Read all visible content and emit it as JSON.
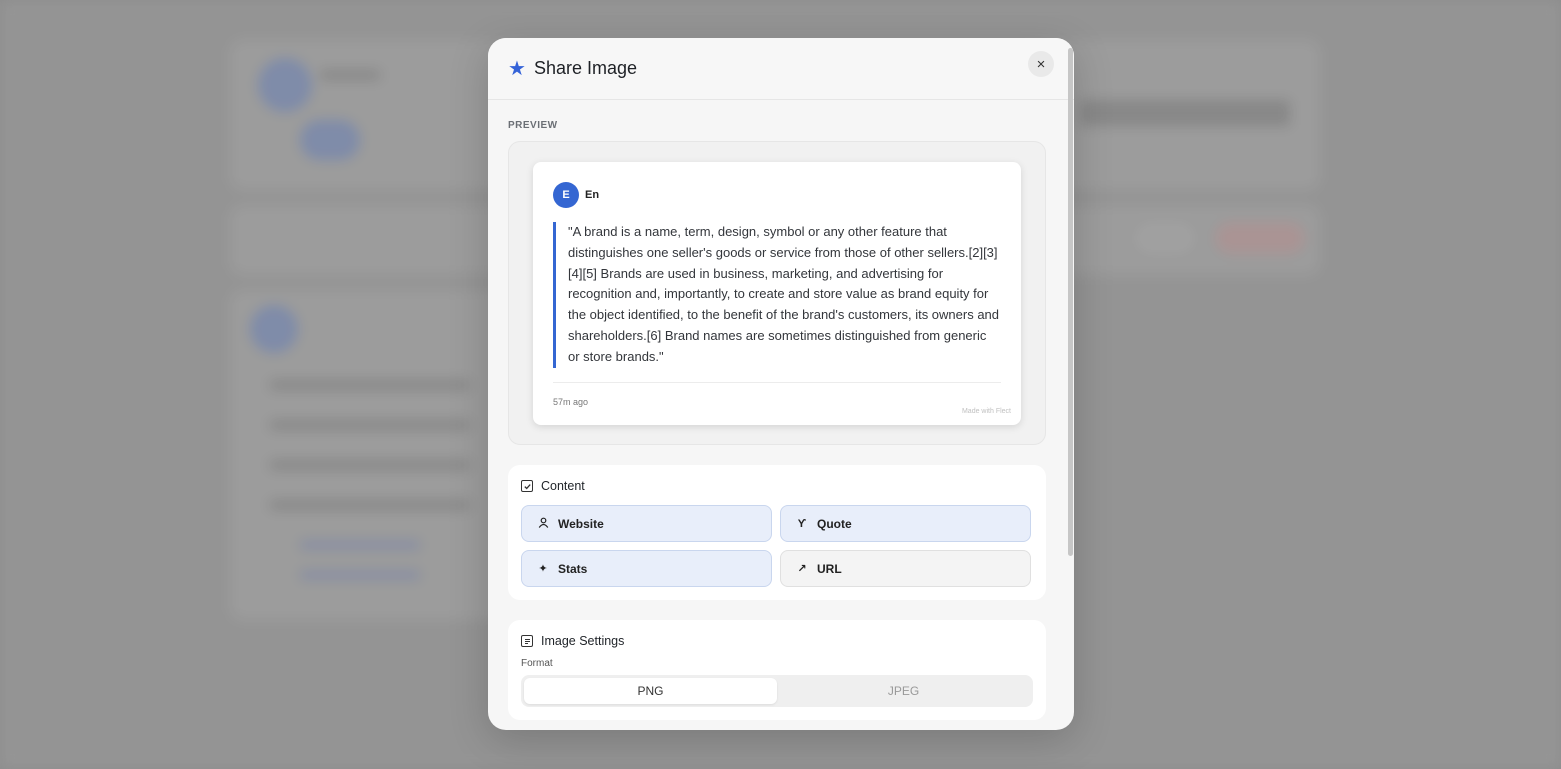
{
  "modal": {
    "title": "Share Image",
    "close_label": "×",
    "accent_color": "#3563d8"
  },
  "preview": {
    "section_label": "PREVIEW",
    "avatar_letter": "E",
    "author": "En",
    "quote": "\"A brand is a name, term, design, symbol or any other feature that distinguishes one seller's goods or service from those of other sellers.[2][3][4][5] Brands are used in business, marketing, and advertising for recognition and, importantly, to create and store value as brand equity for the object identified, to the benefit of the brand's customers, its owners and shareholders.[6] Brand names are sometimes distinguished from generic or store brands.\"",
    "time_ago": "57m ago",
    "watermark": "Made with Flect"
  },
  "content": {
    "title": "Content",
    "options": [
      {
        "label": "Website",
        "icon": "person-icon",
        "selected": true
      },
      {
        "label": "Quote",
        "icon": "quote-icon",
        "selected": true
      },
      {
        "label": "Stats",
        "icon": "sparkle-icon",
        "selected": true
      },
      {
        "label": "URL",
        "icon": "arrow-up-right-icon",
        "selected": false
      }
    ]
  },
  "image_settings": {
    "title": "Image Settings",
    "format_label": "Format",
    "formats": [
      "PNG",
      "JPEG"
    ],
    "selected_format": "PNG"
  }
}
